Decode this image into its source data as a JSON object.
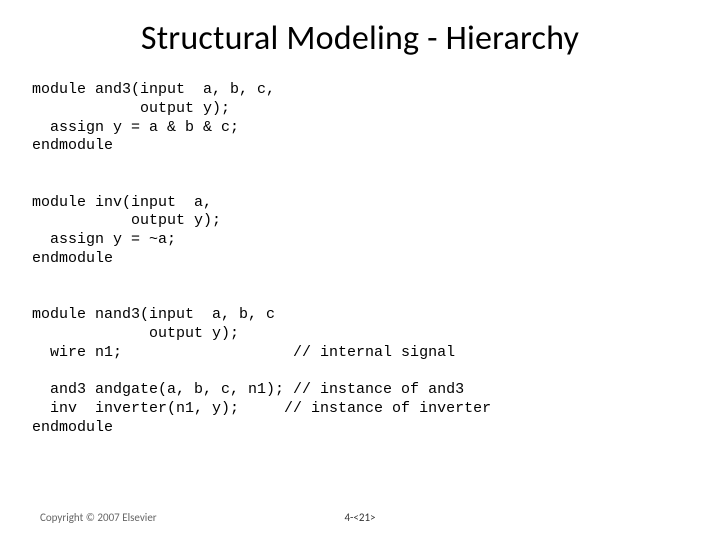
{
  "title": "Structural Modeling - Hierarchy",
  "code": "module and3(input  a, b, c,\n            output y);\n  assign y = a & b & c;\nendmodule\n\n\nmodule inv(input  a,\n           output y);\n  assign y = ~a;\nendmodule\n\n\nmodule nand3(input  a, b, c\n             output y);\n  wire n1;                   // internal signal\n\n  and3 andgate(a, b, c, n1); // instance of and3\n  inv  inverter(n1, y);     // instance of inverter\nendmodule",
  "footer_left": "Copyright © 2007 Elsevier",
  "footer_center": "4-<21>"
}
